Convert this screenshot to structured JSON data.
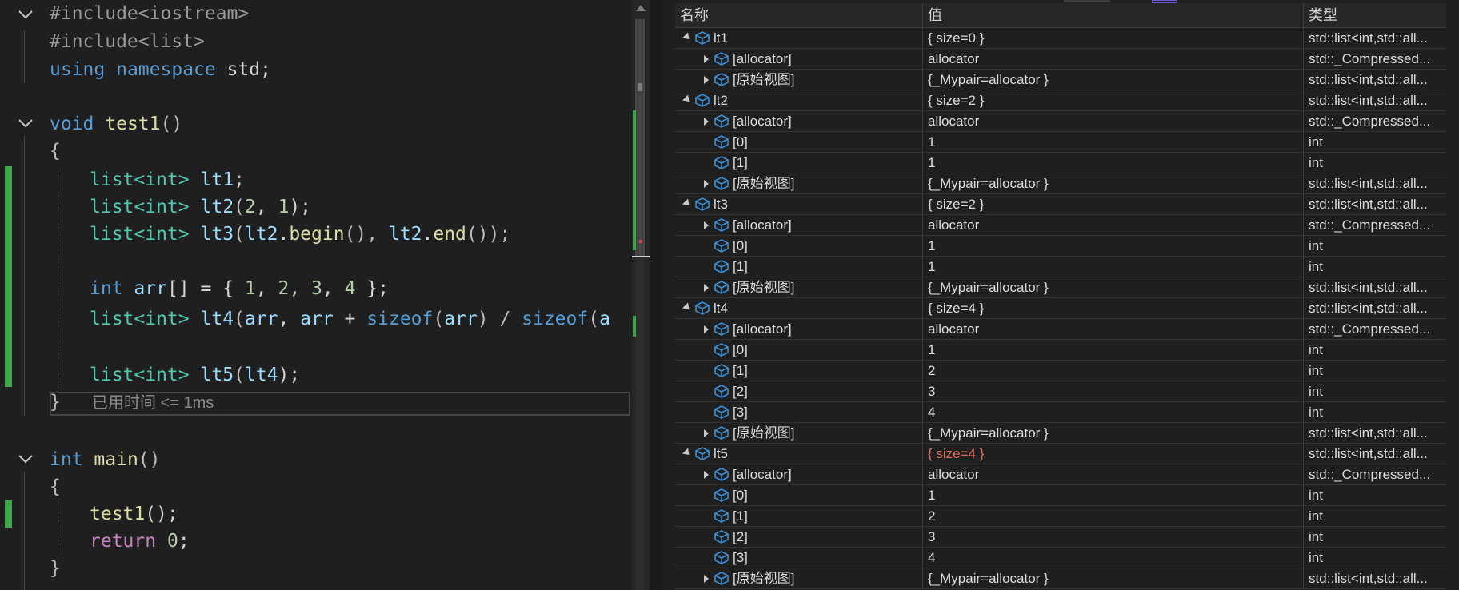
{
  "editor": {
    "lines": {
      "l1": {
        "pre": "#include",
        "inc": "<iostream>"
      },
      "l2": {
        "pre": "#include",
        "inc": "<list>"
      },
      "l3": {
        "kw1": "using",
        "kw2": "namespace",
        "id": "std",
        "end": ";"
      },
      "l4": {
        "kw": "void",
        "fn": "test1",
        "rest": "()"
      },
      "l5": {
        "text": "{"
      },
      "l6": {
        "type": "list",
        "targ": "<int>",
        "var": "lt1",
        "end": ";"
      },
      "l7": {
        "type": "list",
        "targ": "<int>",
        "var": "lt2",
        "p1": "(",
        "n1": "2",
        "p2": ", ",
        "n2": "1",
        "p3": ");"
      },
      "l8": {
        "type": "list",
        "targ": "<int>",
        "var": "lt3",
        "p1": "(",
        "a1": "lt2",
        "d1": ".",
        "m1": "begin",
        "p2": "(), ",
        "a2": "lt2",
        "d2": ".",
        "m2": "end",
        "p3": "());"
      },
      "l9": {
        "kw": "int",
        "var": "arr",
        "mid": "[] = { ",
        "n1": "1",
        "c1": ", ",
        "n2": "2",
        "c2": ", ",
        "n3": "3",
        "c3": ", ",
        "n4": "4",
        "end": " };"
      },
      "l10": {
        "type": "list",
        "targ": "<int>",
        "var": "lt4",
        "p1": "(",
        "a1": "arr",
        "p2": ", ",
        "a2": "arr",
        "op": " + ",
        "kw1": "sizeof",
        "p3": "(",
        "a3": "arr",
        "p4": ") / ",
        "kw2": "sizeof",
        "p5": "(",
        "a4": "a"
      },
      "l11": {
        "type": "list",
        "targ": "<int>",
        "var": "lt5",
        "p1": "(",
        "a1": "lt4",
        "p2": ");"
      },
      "l12": {
        "text": "}"
      },
      "l13": {
        "kw": "int",
        "fn": "main",
        "rest": "()"
      },
      "l14": {
        "text": "{"
      },
      "l15": {
        "fn": "test1",
        "rest": "();"
      },
      "l16": {
        "kw": "return",
        "num": "0",
        "end": ";"
      },
      "l17": {
        "text": "}"
      }
    },
    "elapsed_hint": "已用时间 <= 1ms"
  },
  "watch": {
    "columns": {
      "name": "名称",
      "value": "值",
      "type": "类型"
    },
    "rows": [
      {
        "level": 0,
        "expander": "open",
        "name": "lt1",
        "value": "{ size=0 }",
        "type": "std::list<int,std::all..."
      },
      {
        "level": 1,
        "expander": "closed",
        "name": "[allocator]",
        "value": "allocator",
        "type": "std::_Compressed..."
      },
      {
        "level": 1,
        "expander": "closed",
        "name": "[原始视图]",
        "value": "{_Mypair=allocator }",
        "type": "std::list<int,std::all..."
      },
      {
        "level": 0,
        "expander": "open",
        "name": "lt2",
        "value": "{ size=2 }",
        "type": "std::list<int,std::all..."
      },
      {
        "level": 1,
        "expander": "closed",
        "name": "[allocator]",
        "value": "allocator",
        "type": "std::_Compressed..."
      },
      {
        "level": 1,
        "expander": "none",
        "name": "[0]",
        "value": "1",
        "type": "int"
      },
      {
        "level": 1,
        "expander": "none",
        "name": "[1]",
        "value": "1",
        "type": "int"
      },
      {
        "level": 1,
        "expander": "closed",
        "name": "[原始视图]",
        "value": "{_Mypair=allocator }",
        "type": "std::list<int,std::all..."
      },
      {
        "level": 0,
        "expander": "open",
        "name": "lt3",
        "value": "{ size=2 }",
        "type": "std::list<int,std::all..."
      },
      {
        "level": 1,
        "expander": "closed",
        "name": "[allocator]",
        "value": "allocator",
        "type": "std::_Compressed..."
      },
      {
        "level": 1,
        "expander": "none",
        "name": "[0]",
        "value": "1",
        "type": "int"
      },
      {
        "level": 1,
        "expander": "none",
        "name": "[1]",
        "value": "1",
        "type": "int"
      },
      {
        "level": 1,
        "expander": "closed",
        "name": "[原始视图]",
        "value": "{_Mypair=allocator }",
        "type": "std::list<int,std::all..."
      },
      {
        "level": 0,
        "expander": "open",
        "name": "lt4",
        "value": "{ size=4 }",
        "type": "std::list<int,std::all..."
      },
      {
        "level": 1,
        "expander": "closed",
        "name": "[allocator]",
        "value": "allocator",
        "type": "std::_Compressed..."
      },
      {
        "level": 1,
        "expander": "none",
        "name": "[0]",
        "value": "1",
        "type": "int"
      },
      {
        "level": 1,
        "expander": "none",
        "name": "[1]",
        "value": "2",
        "type": "int"
      },
      {
        "level": 1,
        "expander": "none",
        "name": "[2]",
        "value": "3",
        "type": "int"
      },
      {
        "level": 1,
        "expander": "none",
        "name": "[3]",
        "value": "4",
        "type": "int"
      },
      {
        "level": 1,
        "expander": "closed",
        "name": "[原始视图]",
        "value": "{_Mypair=allocator }",
        "type": "std::list<int,std::all..."
      },
      {
        "level": 0,
        "expander": "open",
        "name": "lt5",
        "value": "{ size=4 }",
        "type": "std::list<int,std::all...",
        "changed": true
      },
      {
        "level": 1,
        "expander": "closed",
        "name": "[allocator]",
        "value": "allocator",
        "type": "std::_Compressed..."
      },
      {
        "level": 1,
        "expander": "none",
        "name": "[0]",
        "value": "1",
        "type": "int"
      },
      {
        "level": 1,
        "expander": "none",
        "name": "[1]",
        "value": "2",
        "type": "int"
      },
      {
        "level": 1,
        "expander": "none",
        "name": "[2]",
        "value": "3",
        "type": "int"
      },
      {
        "level": 1,
        "expander": "none",
        "name": "[3]",
        "value": "4",
        "type": "int"
      },
      {
        "level": 1,
        "expander": "closed",
        "name": "[原始视图]",
        "value": "{_Mypair=allocator }",
        "type": "std::list<int,std::all..."
      }
    ]
  },
  "colors": {
    "changed_value": "#e06c5a",
    "object_icon": "#3a8fd6",
    "added_line": "#3fa54a"
  },
  "icons": {
    "fold": "chevron-down-icon",
    "object": "object-cube-icon",
    "expand_open": "expanded-triangle-icon",
    "expand_closed": "collapsed-triangle-icon"
  }
}
